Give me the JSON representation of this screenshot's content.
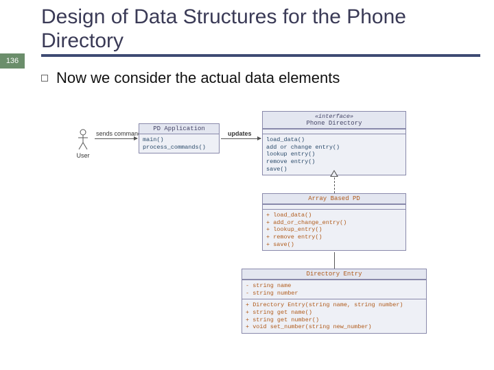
{
  "page_number": "136",
  "title": "Design of Data Structures for the Phone Directory",
  "bullet_text": "Now we consider the actual data elements",
  "actor_label": "User",
  "arrow1_label": "sends command",
  "arrow2_label": "updates",
  "pd_app": {
    "name": "PD Application",
    "ops": [
      "main()",
      "process_commands()"
    ]
  },
  "interface": {
    "stereotype": "«interface»",
    "name": "Phone Directory",
    "ops": [
      "load_data()",
      "add or change entry()",
      "lookup entry()",
      "remove entry()",
      "save()"
    ]
  },
  "array_pd": {
    "name": "Array Based PD",
    "ops": [
      "+ load_data()",
      "+ add_or_change_entry()",
      "+ lookup_entry()",
      "+ remove entry()",
      "+ save()"
    ]
  },
  "dir_entry": {
    "name": "Directory Entry",
    "attrs": [
      "- string name",
      "- string number"
    ],
    "ops": [
      "+ Directory Entry(string name, string number)",
      "+ string get name()",
      "+ string get number()",
      "+ void set_number(string new_number)"
    ]
  }
}
